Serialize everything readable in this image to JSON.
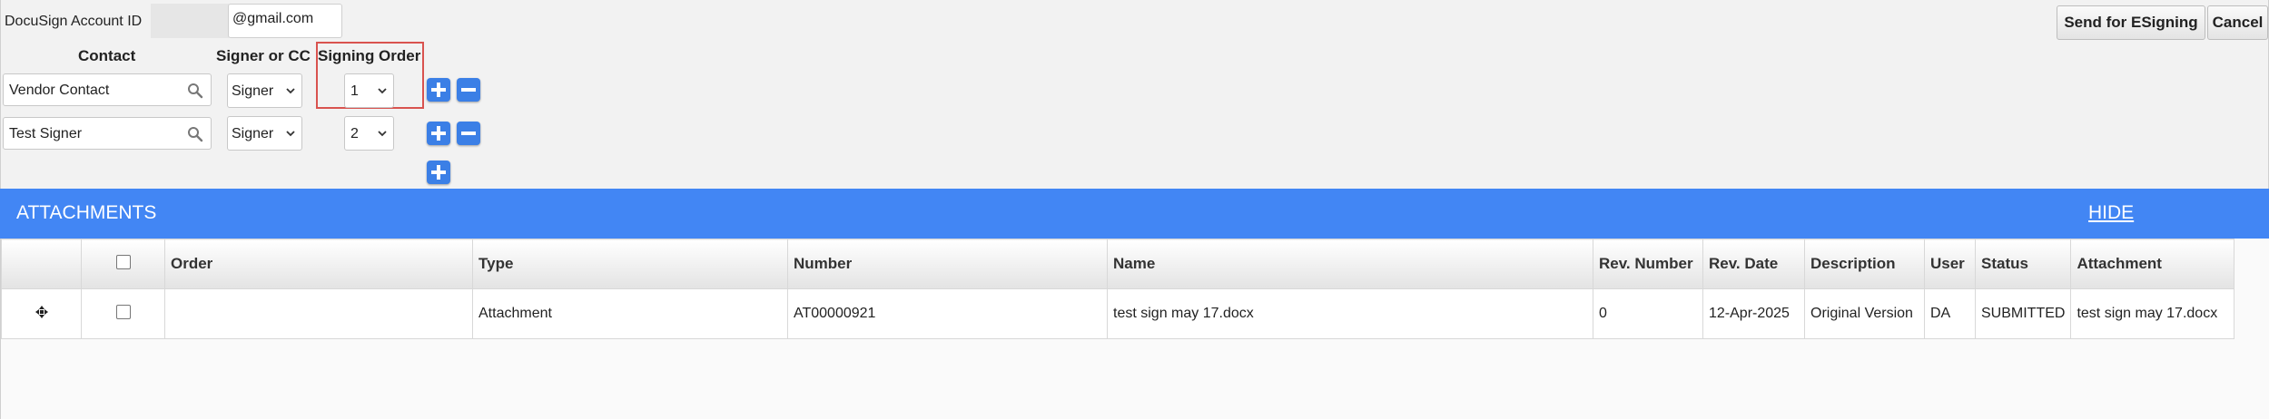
{
  "docusign": {
    "account_id_label": "DocuSign Account ID",
    "email_suffix": "@gmail.com",
    "headers": {
      "contact": "Contact",
      "signer_or_cc": "Signer or CC",
      "signing_order": "Signing Order"
    },
    "rows": [
      {
        "contact": "Vendor Contact",
        "role": "Signer",
        "order": "1"
      },
      {
        "contact": "Test Signer",
        "role": "Signer",
        "order": "2"
      }
    ],
    "send_button": "Send for ESigning",
    "cancel_button": "Cancel"
  },
  "attachments": {
    "title": "ATTACHMENTS",
    "hide_link": "HIDE",
    "columns": [
      "Order",
      "Type",
      "Number",
      "Name",
      "Rev. Number",
      "Rev. Date",
      "Description",
      "User",
      "Status",
      "Attachment"
    ],
    "rows": [
      {
        "order": "",
        "type": "Attachment",
        "number": "AT00000921",
        "name": "test sign may 17.docx",
        "rev_number": "0",
        "rev_date": "12-Apr-2025",
        "description": "Original Version",
        "user": "DA",
        "status": "SUBMITTED",
        "attachment": "test sign may 17.docx"
      }
    ]
  },
  "icons": {
    "search": "search-icon",
    "add": "plus-icon",
    "remove": "minus-icon",
    "dropdown": "chevron-down-icon",
    "move": "move-handle-icon"
  },
  "colors": {
    "accent_blue": "#4286f4",
    "button_blue": "#3b7fe6",
    "highlight_red": "#d9534f"
  }
}
